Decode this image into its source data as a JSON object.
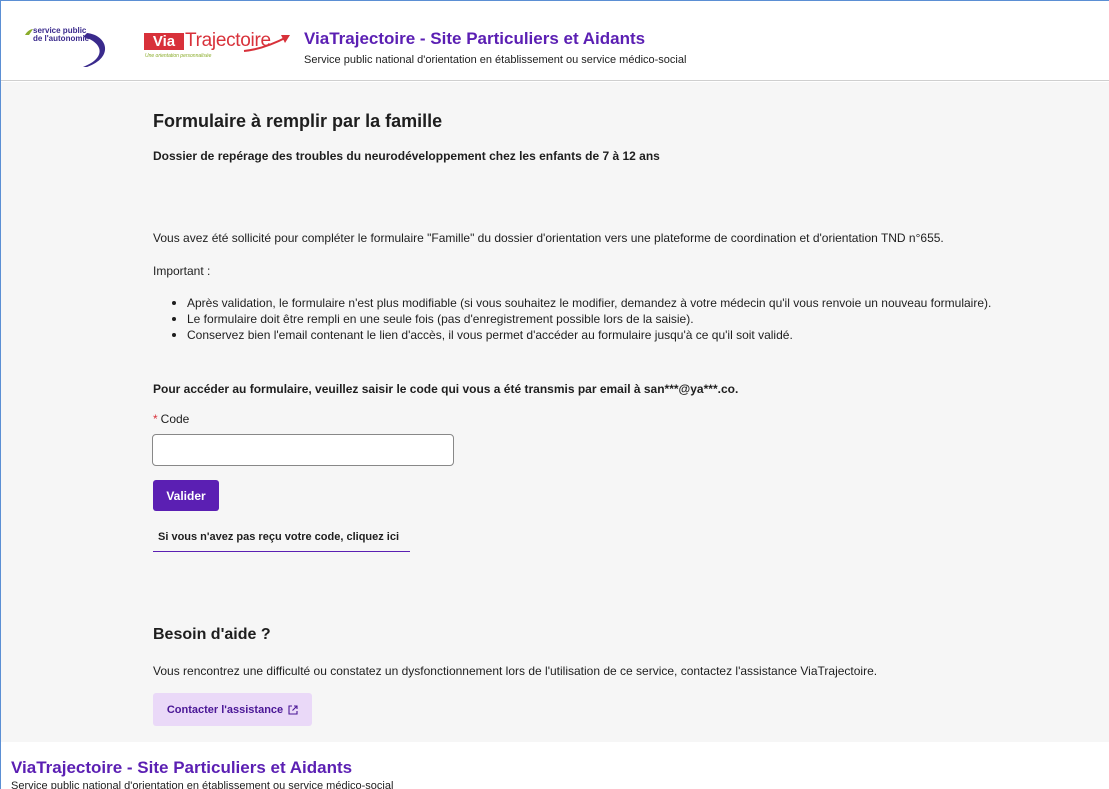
{
  "header": {
    "logo_service_public": "service public de l'autonomie",
    "logo_via": "Via",
    "logo_trajectoire": "Trajectoire",
    "logo_tagline": "Une orientation personnalisée",
    "title": "ViaTrajectoire - Site Particuliers et Aidants",
    "subtitle": "Service public national d'orientation en établissement ou service médico-social"
  },
  "main": {
    "title": "Formulaire à remplir par la famille",
    "subtitle": "Dossier de repérage des troubles du neurodéveloppement chez les enfants de 7 à 12 ans",
    "intro": "Vous avez été sollicité pour compléter le formulaire \"Famille\" du dossier d'orientation vers une plateforme de coordination et d'orientation TND n°655.",
    "important_label": "Important :",
    "bullets": [
      "Après validation, le formulaire n'est plus modifiable (si vous souhaitez le modifier, demandez à votre médecin qu'il vous renvoie un nouveau formulaire).",
      "Le formulaire doit être rempli en une seule fois (pas d'enregistrement possible lors de la saisie).",
      "Conservez bien l'email contenant le lien d'accès, il vous permet d'accéder au formulaire jusqu'à ce qu'il soit validé."
    ],
    "access_text": "Pour accéder au formulaire, veuillez saisir le code qui vous a été transmis par email à san***@ya***.co.",
    "code_required_mark": "*",
    "code_label": "Code",
    "code_value": "",
    "validate_label": "Valider",
    "resend_link": "Si vous n'avez pas reçu votre code, cliquez ici",
    "help_title": "Besoin d'aide ?",
    "help_text": "Vous rencontrez une difficulté ou constatez un dysfonctionnement lors de l'utilisation de ce service, contactez l'assistance ViaTrajectoire.",
    "assist_label": "Contacter l'assistance",
    "assist_icon": "external-link-icon"
  },
  "footer": {
    "title": "ViaTrajectoire - Site Particuliers et Aidants",
    "subtitle": "Service public national d'orientation en établissement ou service médico-social"
  },
  "colors": {
    "brand_purple": "#5b1fb3",
    "assist_bg": "#ead9f8",
    "logo_red": "#d8313a",
    "page_bg": "#f6f6f6"
  }
}
